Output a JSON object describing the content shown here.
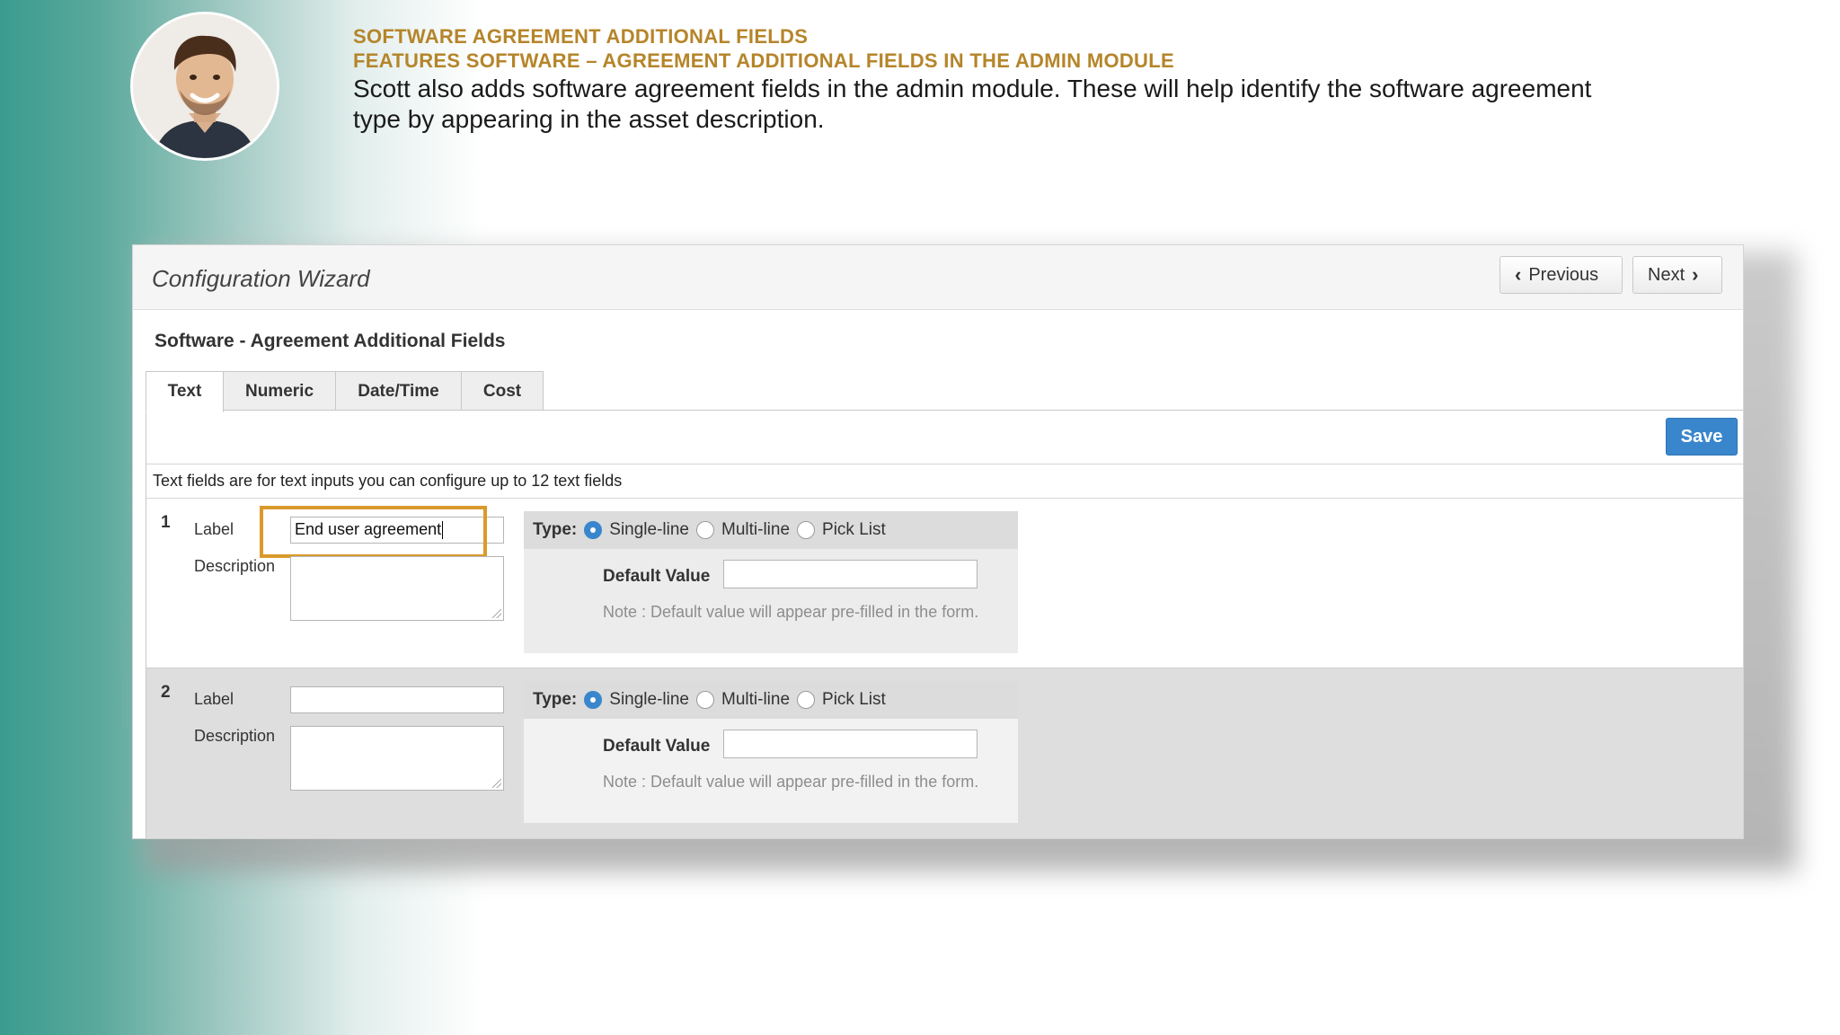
{
  "slide": {
    "heading_line1": "SOFTWARE AGREEMENT ADDITIONAL FIELDS",
    "heading_line2": "FEATURES SOFTWARE – AGREEMENT ADDITIONAL FIELDS IN THE ADMIN MODULE",
    "intro": "Scott also adds software agreement fields in the admin module. These will help identify the software agreement type by appearing in the asset description.",
    "accent_color": "#b5852a",
    "highlight_color": "#d99a2b"
  },
  "wizard": {
    "title": "Configuration Wizard",
    "prev_label": "Previous",
    "next_label": "Next",
    "section_title": "Software - Agreement Additional Fields",
    "tabs": [
      {
        "label": "Text",
        "active": true
      },
      {
        "label": "Numeric",
        "active": false
      },
      {
        "label": "Date/Time",
        "active": false
      },
      {
        "label": "Cost",
        "active": false
      }
    ],
    "save_label": "Save",
    "save_color": "#3a86cc",
    "hint": "Text fields are for text inputs you can configure up to 12 text fields",
    "fields": [
      {
        "number": "1",
        "label_caption": "Label",
        "label_value": "End user agreement",
        "description_caption": "Description",
        "description_value": "",
        "type_caption": "Type:",
        "type_options": [
          "Single-line",
          "Multi-line",
          "Pick List"
        ],
        "selected_type": "Single-line",
        "default_value_caption": "Default Value",
        "default_value": "",
        "note": "Note : Default value will appear pre-filled in the form."
      },
      {
        "number": "2",
        "label_caption": "Label",
        "label_value": "",
        "description_caption": "Description",
        "description_value": "",
        "type_caption": "Type:",
        "type_options": [
          "Single-line",
          "Multi-line",
          "Pick List"
        ],
        "selected_type": "Single-line",
        "default_value_caption": "Default Value",
        "default_value": "",
        "note": "Note : Default value will appear pre-filled in the form."
      }
    ]
  }
}
